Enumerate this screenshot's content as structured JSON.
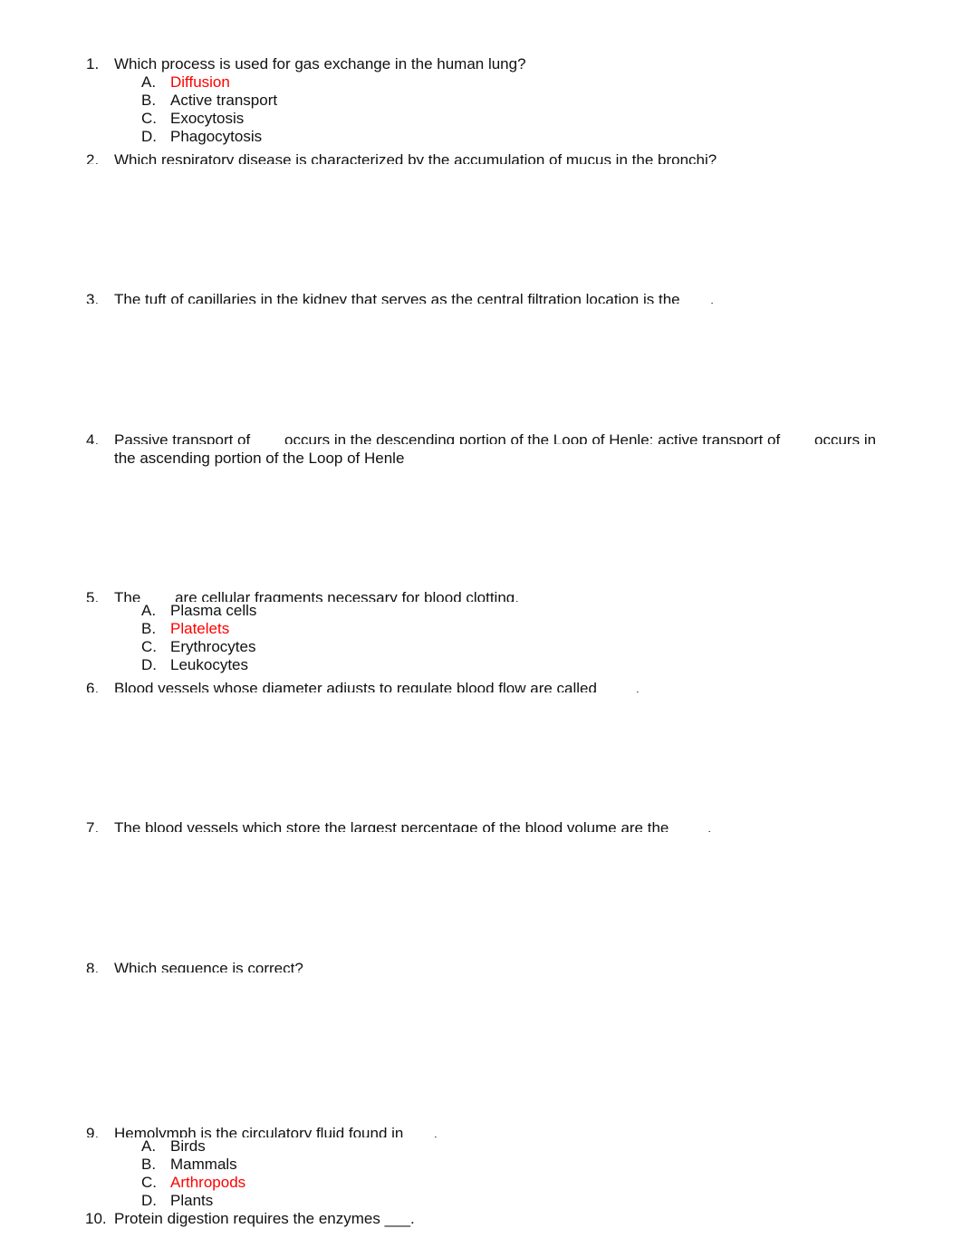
{
  "questions": [
    {
      "num": "1.",
      "text": "Which process is used for gas exchange in the human lung?",
      "options": [
        {
          "letter": "A.",
          "text": "Diffusion",
          "correct": true
        },
        {
          "letter": "B.",
          "text": "Active transport",
          "correct": false
        },
        {
          "letter": "C.",
          "text": "Exocytosis",
          "correct": false
        },
        {
          "letter": "D.",
          "text": "Phagocytosis",
          "correct": false
        }
      ]
    },
    {
      "num": "2.",
      "text": "Which respiratory disease is characterized by the accumulation of mucus in the bronchi?"
    },
    {
      "num": "3.",
      "text": "The tuft of capillaries in the kidney that serves as the central filtration location is the ___."
    },
    {
      "num": "4.",
      "text": "Passive transport of ___ occurs in the descending portion of the Loop of Henle; active transport of ___ occurs in",
      "text2": "the ascending portion of the Loop of Henle"
    },
    {
      "num": "5.",
      "text": "The ___ are cellular fragments necessary for blood clotting.",
      "options": [
        {
          "letter": "A.",
          "text": "Plasma cells",
          "correct": false
        },
        {
          "letter": "B.",
          "text": "Platelets",
          "correct": true
        },
        {
          "letter": "C.",
          "text": "Erythrocytes",
          "correct": false
        },
        {
          "letter": "D.",
          "text": "Leukocytes",
          "correct": false
        }
      ]
    },
    {
      "num": "6.",
      "text": "Blood vessels whose diameter adjusts to regulate blood flow are called ____."
    },
    {
      "num": "7.",
      "text": "The blood vessels which store the largest percentage of the blood volume are the ____."
    },
    {
      "num": "8.",
      "text": "Which sequence is correct?"
    },
    {
      "num": "9.",
      "text": "Hemolymph is the circulatory fluid found in ___.",
      "options": [
        {
          "letter": "A.",
          "text": "Birds",
          "correct": false
        },
        {
          "letter": "B.",
          "text": "Mammals",
          "correct": false
        },
        {
          "letter": "C.",
          "text": "Arthropods",
          "correct": true
        },
        {
          "letter": "D.",
          "text": "Plants",
          "correct": false
        }
      ]
    },
    {
      "num": "10.",
      "text": "Protein digestion requires the enzymes ___."
    }
  ],
  "colors": {
    "text": "#111111",
    "correct_answer": "#ff0000"
  }
}
